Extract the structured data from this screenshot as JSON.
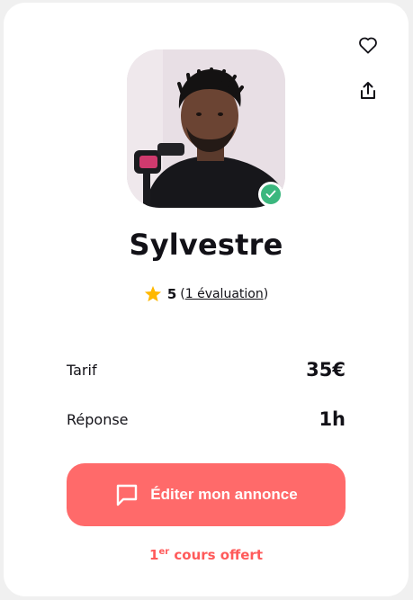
{
  "tutor": {
    "name": "Sylvestre",
    "rating": "5",
    "reviews_link": "1 évaluation",
    "paren_open": "(",
    "paren_close": ")"
  },
  "details": {
    "tarif_label": "Tarif",
    "tarif_value": "35€",
    "reponse_label": "Réponse",
    "reponse_value": "1h"
  },
  "cta": {
    "label": "Éditer mon annonce"
  },
  "offer": {
    "number": "1",
    "superscript": "er",
    "text": " cours offert"
  },
  "colors": {
    "accent": "#ff6a6a",
    "offer": "#ff5a5a",
    "verified": "#3bb77e",
    "star": "#ffb800"
  },
  "icons": {
    "favorite": "heart-icon",
    "share": "share-icon",
    "verified": "check-icon",
    "star": "star-icon",
    "message": "message-icon"
  }
}
